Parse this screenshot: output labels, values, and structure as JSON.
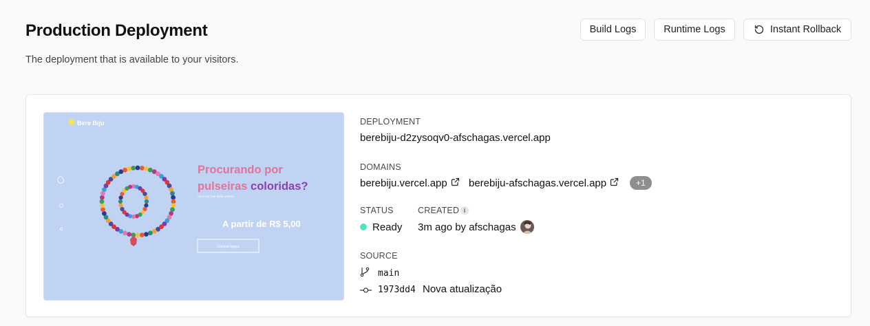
{
  "header": {
    "title": "Production Deployment",
    "subtitle": "The deployment that is available to your visitors."
  },
  "toolbar": {
    "build_logs": "Build Logs",
    "runtime_logs": "Runtime Logs",
    "instant_rollback": "Instant Rollback"
  },
  "preview": {
    "brand": "Bere Biju",
    "headline_1": "Procurando por",
    "headline_2": "pulseiras coloridas?",
    "tagline": "Você vai ficar linda usando",
    "price": "A partir de R$ 5,00",
    "cta": "Compre Agora"
  },
  "deployment": {
    "label": "DEPLOYMENT",
    "url": "berebiju-d2zysoqv0-afschagas.vercel.app"
  },
  "domains": {
    "label": "DOMAINS",
    "items": [
      "berebiju.vercel.app",
      "berebiju-afschagas.vercel.app"
    ],
    "more": "+1"
  },
  "status": {
    "label": "STATUS",
    "value": "Ready",
    "color": "#50e3c2"
  },
  "created": {
    "label": "CREATED",
    "value": "3m ago by afschagas"
  },
  "source": {
    "label": "SOURCE",
    "branch": "main",
    "commit_hash": "1973dd4",
    "commit_message": "Nova atualização"
  },
  "colors": {
    "preview_bg": "#c1d3f3",
    "headline_pink": "#e2739a",
    "headline_purple": "#8b3fb0"
  }
}
